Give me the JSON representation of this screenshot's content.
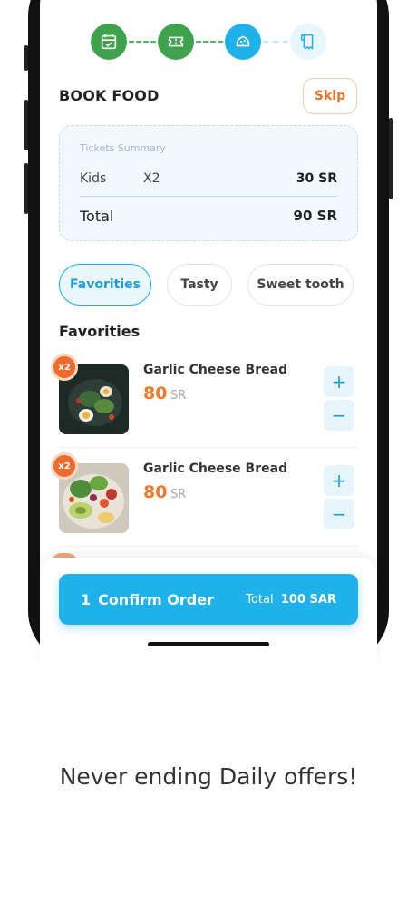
{
  "stepper": {
    "steps": [
      {
        "icon": "calendar-check-icon",
        "state": "done"
      },
      {
        "icon": "ticket-icon",
        "state": "done"
      },
      {
        "icon": "food-icon",
        "state": "active"
      },
      {
        "icon": "receipt-icon",
        "state": "todo"
      }
    ]
  },
  "header": {
    "title": "BOOK FOOD",
    "skip_label": "Skip"
  },
  "summary": {
    "title": "Tickets Summary",
    "row": {
      "label": "Kids",
      "qty": "X2",
      "amount": "30 SR"
    },
    "total": {
      "label": "Total",
      "amount": "90 SR"
    }
  },
  "tabs": [
    "Favorities",
    "Tasty",
    "Sweet tooth"
  ],
  "section_title": "Favorities",
  "items": [
    {
      "badge": "x2",
      "name": "Garlic Cheese Bread",
      "price": "80",
      "currency": "SR",
      "plus": "+",
      "minus": "−"
    },
    {
      "badge": "x2",
      "name": "Garlic Cheese Bread",
      "price": "80",
      "currency": "SR",
      "plus": "+",
      "minus": "−"
    }
  ],
  "confirm": {
    "count": "1",
    "label": "Confirm Order",
    "total_label": "Total",
    "total_value": "100 SAR"
  },
  "tagline": "Never ending Daily offers!",
  "colors": {
    "accent": "#1fb2ea",
    "orange": "#ef7b2d",
    "green": "#3fa34d"
  }
}
